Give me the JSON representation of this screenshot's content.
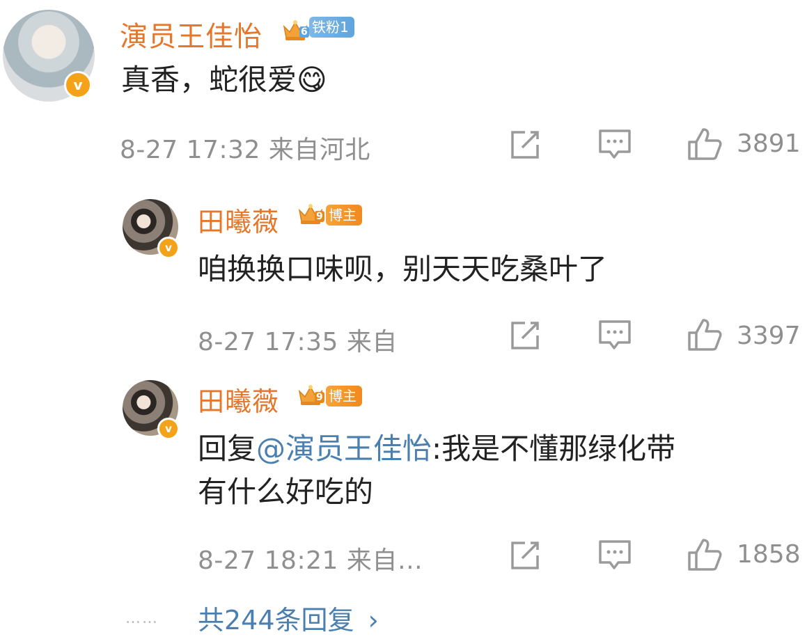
{
  "colors": {
    "name": "#e4772b",
    "mention": "#4a7fb0",
    "meta": "#8f8f8f",
    "icon": "#9a9a9a"
  },
  "comments": [
    {
      "user": "演员王佳怡",
      "badge": "铁粉1",
      "badge_level": "6",
      "text": "真香，蛇很爱",
      "emoji": "😋",
      "time": "8-27 17:32 来自河北",
      "likes": "3891"
    }
  ],
  "replies": [
    {
      "user": "田曦薇",
      "badge": "博主",
      "badge_level": "9",
      "text": "咱换换口味呗，别天天吃桑叶了",
      "time": "8-27 17:35 来自",
      "likes": "3397"
    },
    {
      "user": "田曦薇",
      "badge": "博主",
      "badge_level": "9",
      "reply_prefix": "回复",
      "mention": "@演员王佳怡",
      "text_line1": ":我是不懂那绿化带",
      "text_line2": "有什么好吃的",
      "time": "8-27 18:21 来自…",
      "likes": "1858"
    }
  ],
  "footer": {
    "dots": "……",
    "more_replies": "共244条回复",
    "chevron": "›"
  },
  "icons": [
    "share-icon",
    "comment-icon",
    "like-icon",
    "verified-v-icon",
    "crown-icon"
  ]
}
